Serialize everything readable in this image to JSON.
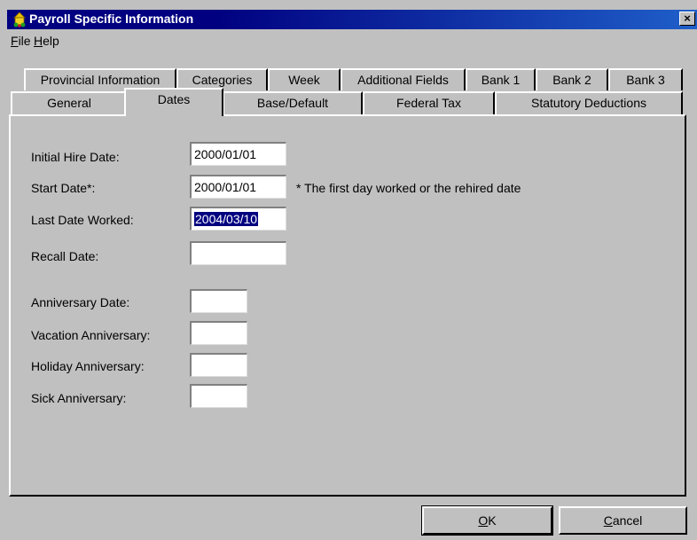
{
  "window": {
    "title": "Payroll Specific Information",
    "close_glyph": "×"
  },
  "menu": {
    "file": {
      "accel": "F",
      "rest": "ile"
    },
    "help": {
      "accel": "H",
      "rest": "elp"
    }
  },
  "tabs_row1": [
    "Provincial Information",
    "Categories",
    "Week",
    "Additional Fields",
    "Bank 1",
    "Bank 2",
    "Bank 3"
  ],
  "tabs_row2": [
    "General",
    "Dates",
    "Base/Default",
    "Federal Tax",
    "Statutory Deductions"
  ],
  "active_tab": "Dates",
  "fields": {
    "initial_hire": {
      "label": "Initial Hire Date:",
      "value": "2000/01/01"
    },
    "start": {
      "label": "Start Date*:",
      "value": "2000/01/01",
      "note": "* The first day worked or the rehired date"
    },
    "last_worked": {
      "label": "Last Date Worked:",
      "value": "2004/03/10"
    },
    "recall": {
      "label": "Recall Date:",
      "value": ""
    },
    "anniversary": {
      "label": "Anniversary Date:",
      "value": ""
    },
    "vacation_anniversary": {
      "label": "Vacation Anniversary:",
      "value": ""
    },
    "holiday_anniversary": {
      "label": "Holiday Anniversary:",
      "value": ""
    },
    "sick_anniversary": {
      "label": "Sick Anniversary:",
      "value": ""
    }
  },
  "buttons": {
    "ok": {
      "accel": "O",
      "rest": "K"
    },
    "cancel": {
      "accel": "C",
      "rest": "ancel"
    }
  }
}
